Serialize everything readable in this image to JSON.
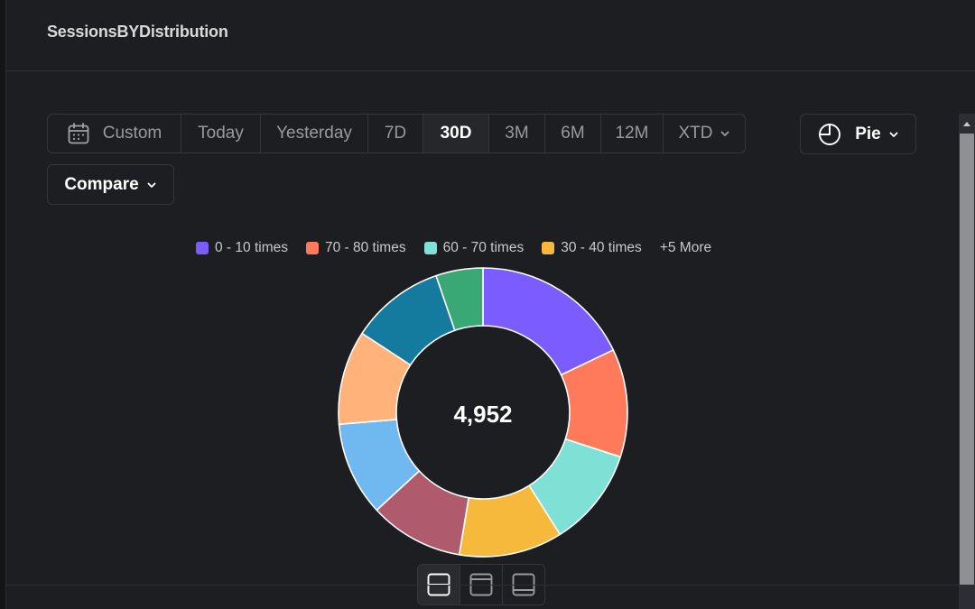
{
  "page": {
    "title": "SessionsBYDistribution"
  },
  "date_range": {
    "options": [
      {
        "label": "Custom",
        "icon": "calendar-icon"
      },
      {
        "label": "Today"
      },
      {
        "label": "Yesterday"
      },
      {
        "label": "7D"
      },
      {
        "label": "30D",
        "active": true
      },
      {
        "label": "3M"
      },
      {
        "label": "6M"
      },
      {
        "label": "12M"
      },
      {
        "label": "XTD",
        "icon": "chevron-down-icon"
      }
    ]
  },
  "chart_type": {
    "label": "Pie",
    "icon": "pie-chart-icon"
  },
  "compare": {
    "label": "Compare",
    "icon": "chevron-down-icon"
  },
  "legend": {
    "items": [
      {
        "label": "0 - 10 times",
        "color": "#7b5cff"
      },
      {
        "label": "70 - 80 times",
        "color": "#ff7a5a"
      },
      {
        "label": "60 - 70 times",
        "color": "#7fe0d5"
      },
      {
        "label": "30 - 40 times",
        "color": "#f7b93b"
      }
    ],
    "more": "+5 More"
  },
  "chart_data": {
    "type": "pie",
    "variant": "donut",
    "total_label": "4,952",
    "slices": [
      {
        "color": "#7b5cff",
        "share": 0.17
      },
      {
        "color": "#ff7a5a",
        "share": 0.115
      },
      {
        "color": "#7fe0d5",
        "share": 0.105
      },
      {
        "color": "#f7b93b",
        "share": 0.11
      },
      {
        "color": "#b05a6e",
        "share": 0.1
      },
      {
        "color": "#6fb8f0",
        "share": 0.1
      },
      {
        "color": "#ffb27a",
        "share": 0.1
      },
      {
        "color": "#147a9e",
        "share": 0.1
      },
      {
        "color": "#3aa874",
        "share": 0.05
      }
    ]
  },
  "view_toggle": {
    "options": [
      {
        "icon": "split-view-icon",
        "active": true
      },
      {
        "icon": "top-panel-icon"
      },
      {
        "icon": "bottom-panel-icon"
      }
    ]
  }
}
